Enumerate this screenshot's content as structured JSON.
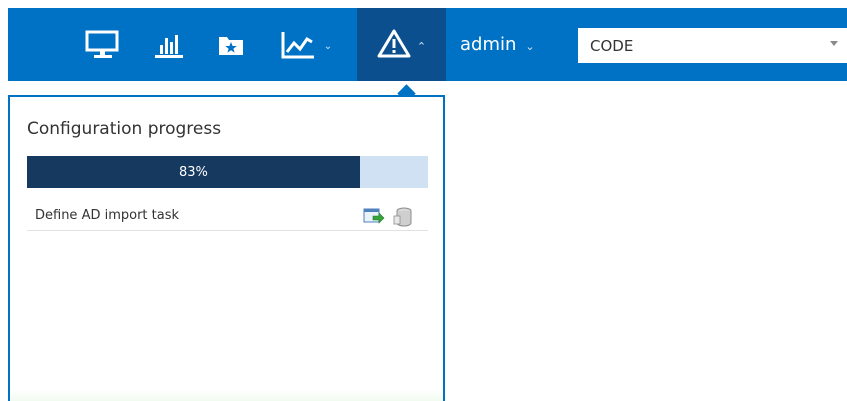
{
  "toolbar": {
    "icons": [
      "monitor-icon",
      "bar-chart-icon",
      "favorites-folder-icon",
      "line-chart-icon",
      "warning-icon"
    ],
    "user_label": "admin",
    "code_select_value": "CODE"
  },
  "config_popup": {
    "title": "Configuration progress",
    "progress_value": 0.83,
    "progress_text": "83%",
    "tasks": [
      {
        "label": "Define AD import task",
        "icons": [
          "execute-task-icon",
          "database-icon"
        ]
      }
    ]
  },
  "colors": {
    "topbar": "#0072c6",
    "active_tab": "#0b4f8f",
    "progress_fill": "#15395f",
    "progress_track": "#cfe1f3"
  }
}
